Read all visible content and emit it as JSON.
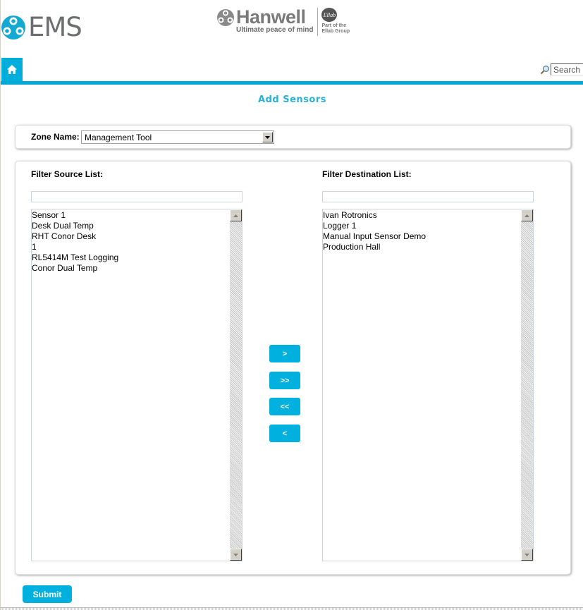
{
  "header": {
    "app_logo_text": "EMS",
    "brand_name": "Hanwell",
    "brand_tagline": "Ultimate peace of mind",
    "partner_logo_text": "Ellab",
    "partner_line1": "Part of the",
    "partner_line2": "Ellab Group"
  },
  "nav": {
    "home_icon": "home-icon",
    "search_icon": "magnifier-icon",
    "search_placeholder": "Search"
  },
  "page": {
    "title": "Add Sensors"
  },
  "zone": {
    "label": "Zone Name:",
    "selected": "Management Tool"
  },
  "source": {
    "label": "Filter Source List:",
    "filter_value": "",
    "items": [
      "Sensor 1",
      "Desk Dual Temp",
      "RHT Conor Desk",
      "1",
      "RL5414M Test Logging",
      "Conor Dual Temp"
    ]
  },
  "destination": {
    "label": "Filter Destination List:",
    "filter_value": "",
    "items": [
      "Ivan Rotronics",
      "Logger 1",
      "Manual Input Sensor Demo",
      "Production Hall"
    ]
  },
  "actions": {
    "move_selected_right": ">",
    "move_all_right": ">>",
    "move_all_left": "<<",
    "move_selected_left": "<",
    "submit": "Submit"
  },
  "colors": {
    "accent": "#00b0de",
    "title": "#2cb0d6",
    "logo_grey": "#6d6e70"
  }
}
